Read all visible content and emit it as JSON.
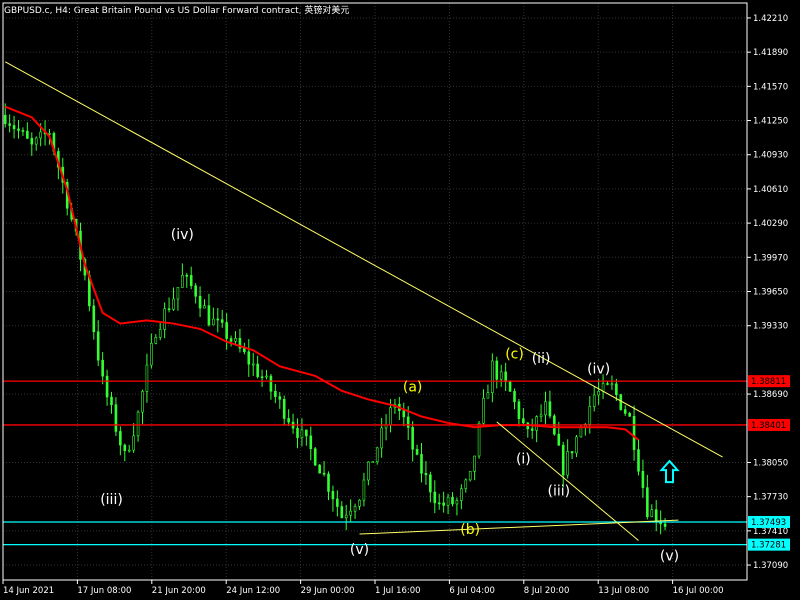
{
  "chart_title": "GBPUSD.c, H4:  Great Britain Pound vs US Dollar Forward contract, 英镑对美元",
  "chart_data": {
    "type": "candlestick",
    "symbol": "GBPUSD.c",
    "timeframe": "H4",
    "ylim": [
      1.3695,
      1.4235
    ],
    "y_ticks": [
      "1.42210",
      "1.41890",
      "1.41570",
      "1.41250",
      "1.40930",
      "1.40610",
      "1.40290",
      "1.39970",
      "1.39650",
      "1.39330",
      "1.38690",
      "1.38050",
      "1.37730",
      "1.37410",
      "1.37090"
    ],
    "x_ticks": [
      "14 Jun 2021",
      "17 Jun 08:00",
      "21 Jun 20:00",
      "24 Jun 12:00",
      "29 Jun 00:00",
      "1 Jul 16:00",
      "6 Jul 04:00",
      "8 Jul 20:00",
      "13 Jul 08:00",
      "16 Jul 00:00"
    ],
    "bars": 168,
    "price_path": [
      [
        0,
        1.413
      ],
      [
        6,
        1.41
      ],
      [
        10,
        1.4115
      ],
      [
        14,
        1.405
      ],
      [
        18,
        1.398
      ],
      [
        22,
        1.388
      ],
      [
        27,
        1.381
      ],
      [
        30,
        1.385
      ],
      [
        34,
        1.393
      ],
      [
        38,
        1.396
      ],
      [
        40,
        1.3978
      ],
      [
        43,
        1.3965
      ],
      [
        46,
        1.394
      ],
      [
        50,
        1.3925
      ],
      [
        54,
        1.3905
      ],
      [
        58,
        1.3885
      ],
      [
        62,
        1.386
      ],
      [
        66,
        1.3835
      ],
      [
        70,
        1.381
      ],
      [
        74,
        1.3775
      ],
      [
        76,
        1.3755
      ],
      [
        80,
        1.3775
      ],
      [
        84,
        1.382
      ],
      [
        88,
        1.3862
      ],
      [
        90,
        1.3845
      ],
      [
        93,
        1.3805
      ],
      [
        96,
        1.3782
      ],
      [
        98,
        1.3765
      ],
      [
        102,
        1.3768
      ],
      [
        105,
        1.379
      ],
      [
        108,
        1.3858
      ],
      [
        110,
        1.3895
      ],
      [
        114,
        1.387
      ],
      [
        118,
        1.383
      ],
      [
        122,
        1.3856
      ],
      [
        126,
        1.38
      ],
      [
        129,
        1.3828
      ],
      [
        133,
        1.3868
      ],
      [
        137,
        1.3875
      ],
      [
        141,
        1.3846
      ],
      [
        145,
        1.3762
      ],
      [
        149,
        1.3748
      ]
    ],
    "moving_average": [
      [
        0,
        1.4138
      ],
      [
        6,
        1.4128
      ],
      [
        10,
        1.411
      ],
      [
        14,
        1.406
      ],
      [
        18,
        1.399
      ],
      [
        22,
        1.3945
      ],
      [
        26,
        1.3935
      ],
      [
        32,
        1.3938
      ],
      [
        38,
        1.3935
      ],
      [
        44,
        1.393
      ],
      [
        50,
        1.3918
      ],
      [
        56,
        1.391
      ],
      [
        62,
        1.3895
      ],
      [
        70,
        1.3886
      ],
      [
        76,
        1.3872
      ],
      [
        82,
        1.3864
      ],
      [
        88,
        1.3858
      ],
      [
        94,
        1.3848
      ],
      [
        100,
        1.3842
      ],
      [
        106,
        1.3838
      ],
      [
        112,
        1.384
      ],
      [
        118,
        1.384
      ],
      [
        124,
        1.3838
      ],
      [
        130,
        1.3838
      ],
      [
        136,
        1.3838
      ],
      [
        140,
        1.3836
      ],
      [
        143,
        1.3826
      ]
    ],
    "horizontal_levels": [
      {
        "label": "1.38811",
        "price": 1.38811,
        "color": "#ff0000"
      },
      {
        "label": "1.38401",
        "price": 1.38401,
        "color": "#ff0000"
      },
      {
        "label": "1.37493",
        "price": 1.37493,
        "color": "#00ffff"
      },
      {
        "label": "1.37281",
        "price": 1.37281,
        "color": "#00ffff"
      }
    ],
    "trendlines": [
      {
        "color": "#ffff66",
        "from": [
          0,
          1.418
        ],
        "to": [
          162,
          1.381
        ]
      },
      {
        "color": "#ffff66",
        "from": [
          80,
          1.3738
        ],
        "to": [
          152,
          1.3751
        ]
      },
      {
        "color": "#ffff66",
        "from": [
          111,
          1.3843
        ],
        "to": [
          143,
          1.3732
        ]
      }
    ],
    "annotations": [
      {
        "text": "(iv)",
        "bar": 40,
        "price": 1.4018,
        "color": "#ffffff"
      },
      {
        "text": "(iii)",
        "bar": 24,
        "price": 1.377,
        "color": "#ffffff"
      },
      {
        "text": "(v)",
        "bar": 80,
        "price": 1.3723,
        "color": "#ffffff"
      },
      {
        "text": "(a)",
        "bar": 92,
        "price": 1.3875,
        "color": "#ffff00"
      },
      {
        "text": "(b)",
        "bar": 105,
        "price": 1.3742,
        "color": "#ffff00"
      },
      {
        "text": "(c)",
        "bar": 115,
        "price": 1.3906,
        "color": "#ffff00"
      },
      {
        "text": "(ii)",
        "bar": 121,
        "price": 1.3902,
        "color": "#ffffff"
      },
      {
        "text": "(i)",
        "bar": 117,
        "price": 1.3808,
        "color": "#ffffff"
      },
      {
        "text": "(iii)",
        "bar": 125,
        "price": 1.3778,
        "color": "#ffffff"
      },
      {
        "text": "(iv)",
        "bar": 134,
        "price": 1.3892,
        "color": "#ffffff"
      },
      {
        "text": "(v)",
        "bar": 150,
        "price": 1.3717,
        "color": "#ffffff"
      }
    ],
    "arrow": {
      "direction": "up",
      "color": "#00ffff",
      "bar": 150,
      "price": 1.3796
    },
    "colors": {
      "candles": "#33ff33",
      "moving_average": "#ff0000",
      "grid": "#333333",
      "axis": "#ffffff"
    }
  }
}
